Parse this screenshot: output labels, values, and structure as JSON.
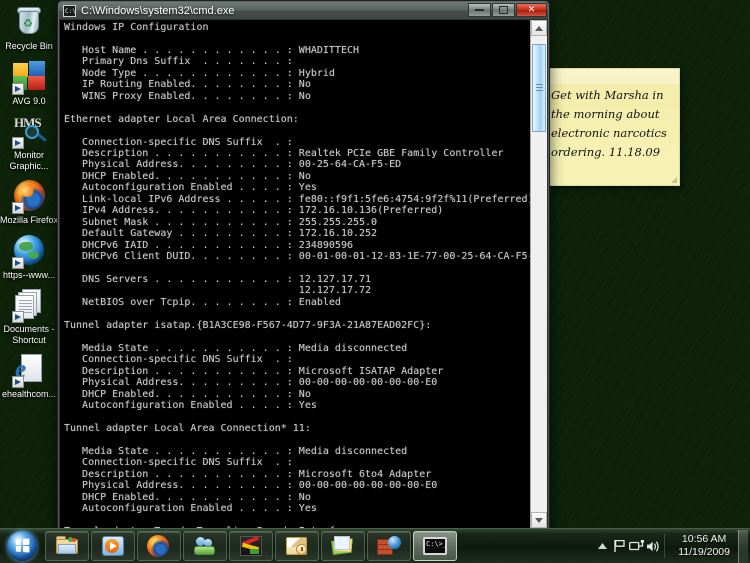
{
  "desktop": {
    "icons": [
      {
        "name": "recycle-bin",
        "label": "Recycle Bin",
        "icon": "recycle-bin-icon"
      },
      {
        "name": "avg",
        "label": "AVG 9.0",
        "icon": "avg-shield-icon"
      },
      {
        "name": "monitor-graphic",
        "label": "Monitor Graphic...",
        "icon": "monitor-magnifier-icon"
      },
      {
        "name": "mozilla-firefox",
        "label": "Mozilla Firefox",
        "icon": "firefox-icon"
      },
      {
        "name": "https-www",
        "label": "https--www...",
        "icon": "globe-shortcut-icon"
      },
      {
        "name": "documents-shortcut",
        "label": "Documents - Shortcut",
        "icon": "documents-icon"
      },
      {
        "name": "ehealthcom",
        "label": "ehealthcom...",
        "icon": "internet-explorer-icon"
      }
    ]
  },
  "sticky_note": {
    "text": "Get with Marsha in the morning about electronic narcotics ordering.  11.18.09",
    "color": "#f6f2ad"
  },
  "cmd_window": {
    "title": "C:\\Windows\\system32\\cmd.exe",
    "icon_label": "C:\\",
    "buttons": {
      "minimize": "Minimize",
      "maximize": "Maximize",
      "close": "Close"
    },
    "console_text": "Windows IP Configuration\n\n   Host Name . . . . . . . . . . . . : WHADITTECH\n   Primary Dns Suffix  . . . . . . . :\n   Node Type . . . . . . . . . . . . : Hybrid\n   IP Routing Enabled. . . . . . . . : No\n   WINS Proxy Enabled. . . . . . . . : No\n\nEthernet adapter Local Area Connection:\n\n   Connection-specific DNS Suffix  . :\n   Description . . . . . . . . . . . : Realtek PCIe GBE Family Controller\n   Physical Address. . . . . . . . . : 00-25-64-CA-F5-ED\n   DHCP Enabled. . . . . . . . . . . : No\n   Autoconfiguration Enabled . . . . : Yes\n   Link-local IPv6 Address . . . . . : fe80::f9f1:5fe6:4754:9f2f%11(Preferred)\n   IPv4 Address. . . . . . . . . . . : 172.16.10.136(Preferred)\n   Subnet Mask . . . . . . . . . . . : 255.255.255.0\n   Default Gateway . . . . . . . . . : 172.16.10.252\n   DHCPv6 IAID . . . . . . . . . . . : 234890596\n   DHCPv6 Client DUID. . . . . . . . : 00-01-00-01-12-83-1E-77-00-25-64-CA-F5-ED\n\n   DNS Servers . . . . . . . . . . . : 12.127.17.71\n                                       12.127.17.72\n   NetBIOS over Tcpip. . . . . . . . : Enabled\n\nTunnel adapter isatap.{B1A3CE98-F567-4D77-9F3A-21A87EAD02FC}:\n\n   Media State . . . . . . . . . . . : Media disconnected\n   Connection-specific DNS Suffix  . :\n   Description . . . . . . . . . . . : Microsoft ISATAP Adapter\n   Physical Address. . . . . . . . . : 00-00-00-00-00-00-00-E0\n   DHCP Enabled. . . . . . . . . . . : No\n   Autoconfiguration Enabled . . . . : Yes\n\nTunnel adapter Local Area Connection* 11:\n\n   Media State . . . . . . . . . . . : Media disconnected\n   Connection-specific DNS Suffix  . :\n   Description . . . . . . . . . . . : Microsoft 6to4 Adapter\n   Physical Address. . . . . . . . . : 00-00-00-00-00-00-00-E0\n   DHCP Enabled. . . . . . . . . . . : No\n   Autoconfiguration Enabled . . . . : Yes\n\nTunnel adapter Teredo Tunneling Pseudo-Interface:\n\n   Connection-specific DNS Suffix  . :\n   Description . . . . . . . . . . . : Teredo Tunneling Pseudo-Interface\n   Physical Address. . . . . . . . . : 00-00-00-00-00-00-00-E0\n   DHCP Enabled. . . . . . . . . . . : No\n   Autoconfiguration Enabled . . . . : Yes\n   IPv6 Address. . . . . . . . . . . : 2001:0:4137:9e50:2c1c:38ae:f347:8b82(Pref\nerred)\n   Link-local IPv6 Address . . . . . : fe80::2c1c:38ae:f347:8b82%14(Preferred)\n   Default Gateway . . . . . . . . . : ::\n   NetBIOS over Tcpip. . . . . . . . : Disabled"
  },
  "taskbar": {
    "start_label": "Start",
    "buttons": [
      {
        "name": "windows-explorer",
        "icon": "folder-icon",
        "active": false
      },
      {
        "name": "windows-media-player",
        "icon": "media-player-icon",
        "active": false
      },
      {
        "name": "mozilla-firefox",
        "icon": "firefox-icon",
        "active": false
      },
      {
        "name": "windows-live-messenger",
        "icon": "messenger-people-icon",
        "active": false
      },
      {
        "name": "red-app",
        "icon": "red-yellow-app-icon",
        "active": false
      },
      {
        "name": "microsoft-outlook",
        "icon": "outlook-envelope-clock-icon",
        "active": false
      },
      {
        "name": "sticky-notes",
        "icon": "sticky-notes-icon",
        "active": false
      },
      {
        "name": "firewall",
        "icon": "firewall-brick-globe-icon",
        "active": false
      },
      {
        "name": "command-prompt",
        "icon": "command-prompt-icon",
        "active": true
      }
    ],
    "tray": {
      "show_hidden": "show-hidden-icons",
      "icons": [
        {
          "name": "action-center",
          "icon": "flag-icon"
        },
        {
          "name": "network",
          "icon": "network-icon"
        },
        {
          "name": "volume",
          "icon": "speaker-icon"
        }
      ],
      "time": "10:56 AM",
      "date": "11/19/2009"
    }
  }
}
